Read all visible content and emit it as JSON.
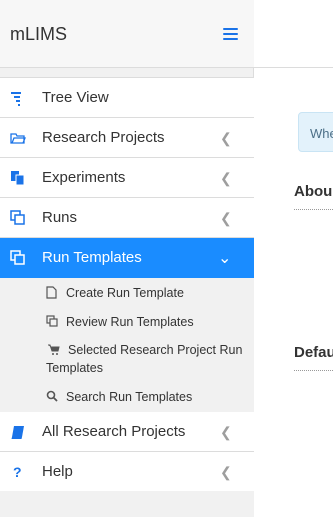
{
  "app": {
    "title": "mLIMS"
  },
  "menu": {
    "tree_view": "Tree View",
    "research_projects": "Research Projects",
    "experiments": "Experiments",
    "runs": "Runs",
    "run_templates": "Run Templates",
    "all_research_projects": "All Research Projects",
    "help": "Help"
  },
  "submenu": {
    "create_run_template": "Create Run Template",
    "review_run_templates": "Review Run Templates",
    "selected_research_project_run_templates_line1": "Selected Research Project Run",
    "selected_research_project_run_templates_line2": "Templates",
    "search_run_templates": "Search Run Templates"
  },
  "main": {
    "alert_text": "Whe",
    "about_heading": "Abou",
    "default_heading": "Defau"
  },
  "colors": {
    "accent": "#1a73e8",
    "active_bg": "#1a8cff",
    "alert_bg": "#e3f2fb"
  }
}
